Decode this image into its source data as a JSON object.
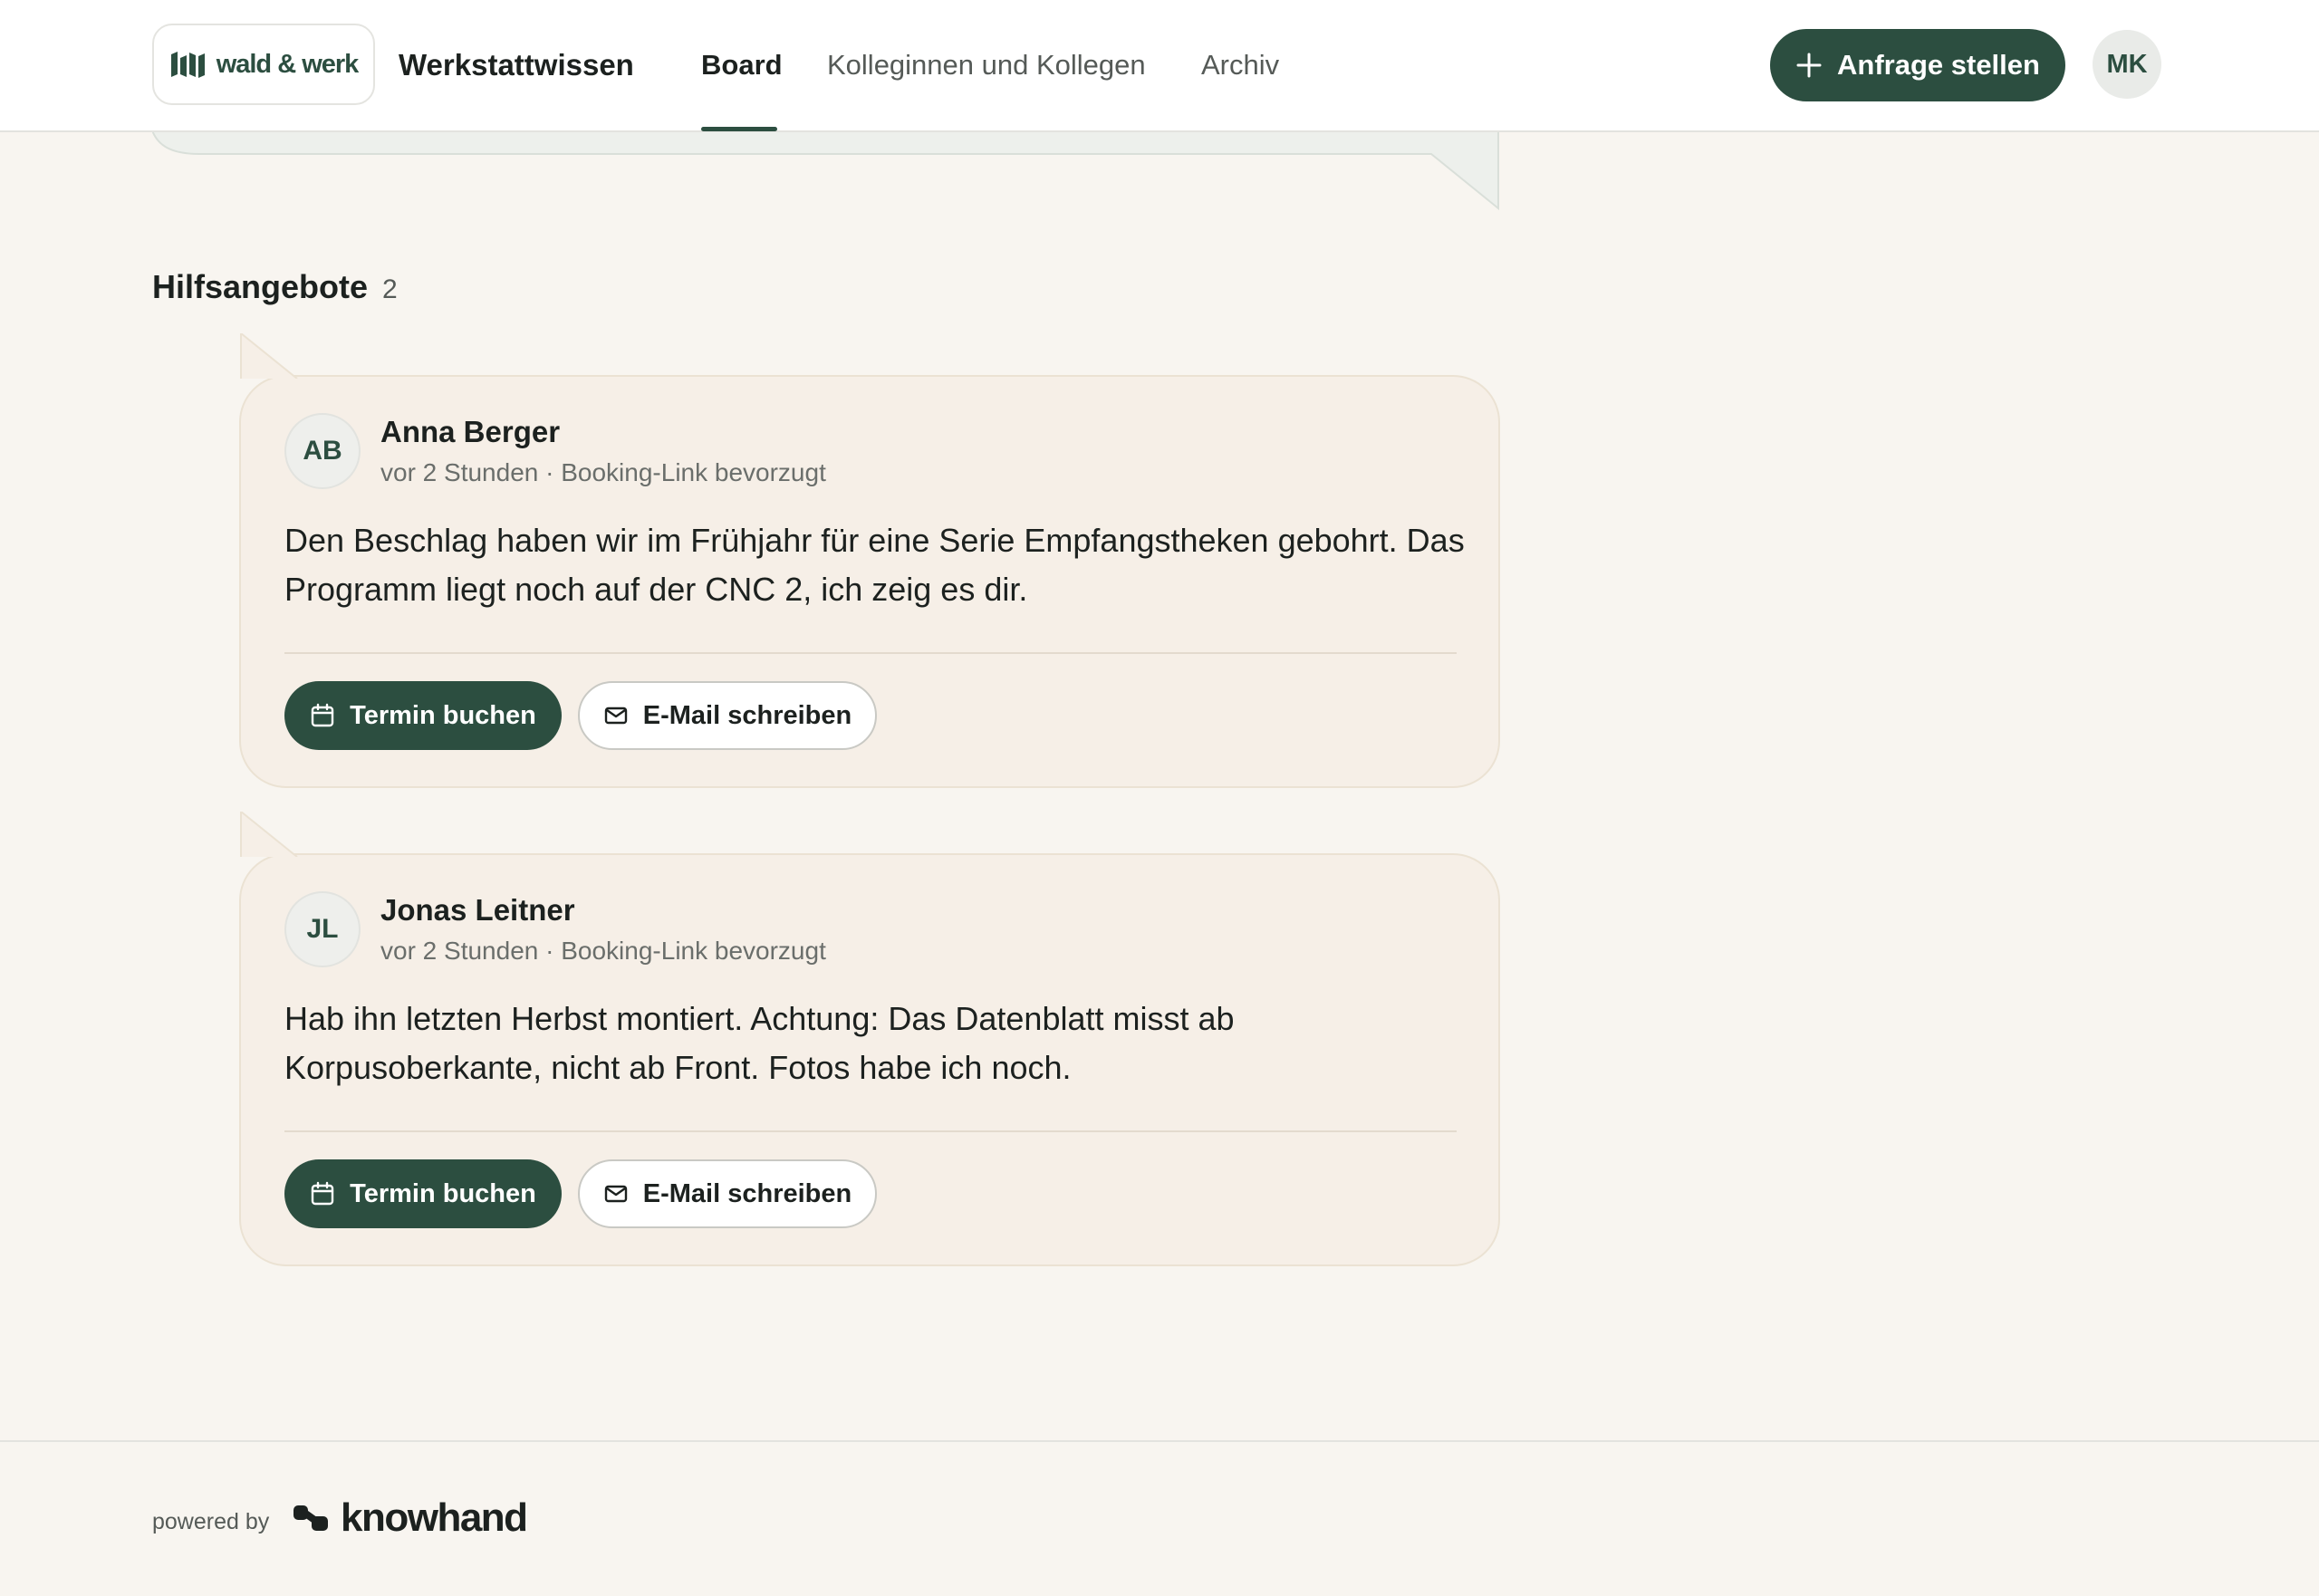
{
  "header": {
    "logo_text": "wald & werk",
    "brand_title": "Werkstattwissen",
    "nav": [
      {
        "label": "Board",
        "active": true
      },
      {
        "label": "Kolleginnen und Kollegen",
        "active": false
      },
      {
        "label": "Archiv",
        "active": false
      }
    ],
    "cta_label": "Anfrage stellen",
    "cta_icon": "plus-icon",
    "user_initials": "MK"
  },
  "section": {
    "title": "Hilfsangebote",
    "count": "2"
  },
  "offers": [
    {
      "initials": "AB",
      "name": "Anna Berger",
      "time": "vor 2 Stunden",
      "separator": "·",
      "preference": "Booking-Link bevorzugt",
      "message": "Den Beschlag haben wir im Frühjahr für eine Serie Empfangstheken gebohrt. Das Programm liegt noch auf der CNC 2, ich zeig es dir.",
      "book_label": "Termin buchen",
      "email_label": "E-Mail schreiben"
    },
    {
      "initials": "JL",
      "name": "Jonas Leitner",
      "time": "vor 2 Stunden",
      "separator": "·",
      "preference": "Booking-Link bevorzugt",
      "message": "Hab ihn letzten Herbst montiert. Achtung: Das Datenblatt misst ab Korpusoberkante, nicht ab Front. Fotos habe ich noch.",
      "book_label": "Termin buchen",
      "email_label": "E-Mail schreiben"
    }
  ],
  "footer": {
    "powered_by": "powered by",
    "brand": "knowhand"
  },
  "colors": {
    "accent": "#2c4e40",
    "background": "#f8f5f0",
    "card": "#f6efe7",
    "remnant_card": "#edf0ec"
  }
}
